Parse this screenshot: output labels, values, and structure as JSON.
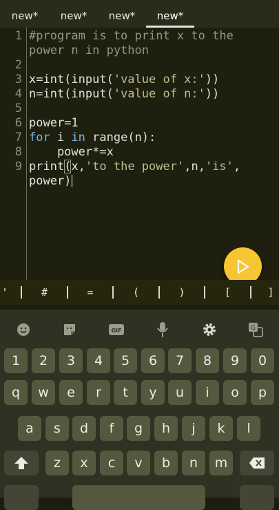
{
  "tabs": [
    "new*",
    "new*",
    "new*",
    "new*"
  ],
  "active_tab": 3,
  "line_numbers": [
    "1",
    "2",
    "3",
    "4",
    "5",
    "6",
    "7",
    "8",
    "9"
  ],
  "code": {
    "l1a": "#program is to print x to the",
    "l1b": "power n in python",
    "l3_pre": "x=int(input(",
    "l3_str": "'value of x:'",
    "l3_post": "))",
    "l4_pre": "n=int(input(",
    "l4_str": "'value of n:'",
    "l4_post": "))",
    "l6": "power=1",
    "l7_kw1": "for",
    "l7_mid": " i ",
    "l7_kw2": "in",
    "l7_post": " range(n):",
    "l8": "    power*=x",
    "l9_pre": "print",
    "l9_paren": "(",
    "l9_mid": "x,",
    "l9_str1": "'to the power'",
    "l9_mid2": ",n,",
    "l9_str2": "'is'",
    "l9_end": ",",
    "l10": "power)"
  },
  "symbols": [
    "'",
    "#",
    "=",
    "(",
    ")",
    "[",
    "]"
  ],
  "keyboard": {
    "row1": [
      "1",
      "2",
      "3",
      "4",
      "5",
      "6",
      "7",
      "8",
      "9",
      "0"
    ],
    "row2": [
      "q",
      "w",
      "e",
      "r",
      "t",
      "y",
      "u",
      "i",
      "o",
      "p"
    ],
    "row3": [
      "a",
      "s",
      "d",
      "f",
      "g",
      "h",
      "j",
      "k",
      "l"
    ],
    "row4": [
      "z",
      "x",
      "c",
      "v",
      "b",
      "n",
      "m"
    ]
  },
  "colors": {
    "accent": "#f6c531",
    "background": "#1f1f10",
    "keyboard": "#2f3123"
  }
}
